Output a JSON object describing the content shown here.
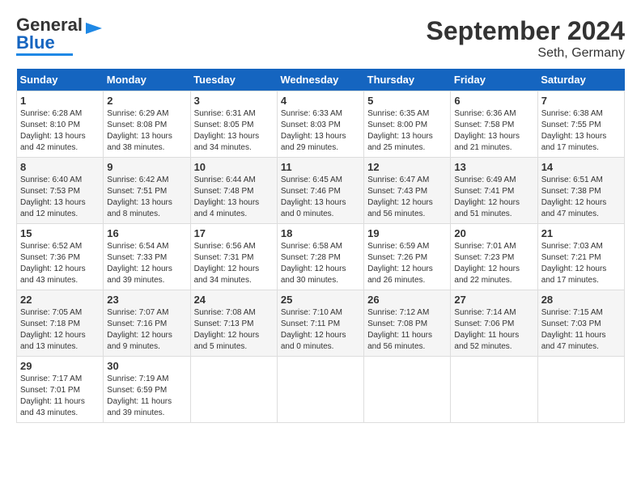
{
  "header": {
    "logo_general": "General",
    "logo_blue": "Blue",
    "title": "September 2024",
    "subtitle": "Seth, Germany"
  },
  "days_of_week": [
    "Sunday",
    "Monday",
    "Tuesday",
    "Wednesday",
    "Thursday",
    "Friday",
    "Saturday"
  ],
  "weeks": [
    [
      {
        "day": "1",
        "info": "Sunrise: 6:28 AM\nSunset: 8:10 PM\nDaylight: 13 hours\nand 42 minutes."
      },
      {
        "day": "2",
        "info": "Sunrise: 6:29 AM\nSunset: 8:08 PM\nDaylight: 13 hours\nand 38 minutes."
      },
      {
        "day": "3",
        "info": "Sunrise: 6:31 AM\nSunset: 8:05 PM\nDaylight: 13 hours\nand 34 minutes."
      },
      {
        "day": "4",
        "info": "Sunrise: 6:33 AM\nSunset: 8:03 PM\nDaylight: 13 hours\nand 29 minutes."
      },
      {
        "day": "5",
        "info": "Sunrise: 6:35 AM\nSunset: 8:00 PM\nDaylight: 13 hours\nand 25 minutes."
      },
      {
        "day": "6",
        "info": "Sunrise: 6:36 AM\nSunset: 7:58 PM\nDaylight: 13 hours\nand 21 minutes."
      },
      {
        "day": "7",
        "info": "Sunrise: 6:38 AM\nSunset: 7:55 PM\nDaylight: 13 hours\nand 17 minutes."
      }
    ],
    [
      {
        "day": "8",
        "info": "Sunrise: 6:40 AM\nSunset: 7:53 PM\nDaylight: 13 hours\nand 12 minutes."
      },
      {
        "day": "9",
        "info": "Sunrise: 6:42 AM\nSunset: 7:51 PM\nDaylight: 13 hours\nand 8 minutes."
      },
      {
        "day": "10",
        "info": "Sunrise: 6:44 AM\nSunset: 7:48 PM\nDaylight: 13 hours\nand 4 minutes."
      },
      {
        "day": "11",
        "info": "Sunrise: 6:45 AM\nSunset: 7:46 PM\nDaylight: 13 hours\nand 0 minutes."
      },
      {
        "day": "12",
        "info": "Sunrise: 6:47 AM\nSunset: 7:43 PM\nDaylight: 12 hours\nand 56 minutes."
      },
      {
        "day": "13",
        "info": "Sunrise: 6:49 AM\nSunset: 7:41 PM\nDaylight: 12 hours\nand 51 minutes."
      },
      {
        "day": "14",
        "info": "Sunrise: 6:51 AM\nSunset: 7:38 PM\nDaylight: 12 hours\nand 47 minutes."
      }
    ],
    [
      {
        "day": "15",
        "info": "Sunrise: 6:52 AM\nSunset: 7:36 PM\nDaylight: 12 hours\nand 43 minutes."
      },
      {
        "day": "16",
        "info": "Sunrise: 6:54 AM\nSunset: 7:33 PM\nDaylight: 12 hours\nand 39 minutes."
      },
      {
        "day": "17",
        "info": "Sunrise: 6:56 AM\nSunset: 7:31 PM\nDaylight: 12 hours\nand 34 minutes."
      },
      {
        "day": "18",
        "info": "Sunrise: 6:58 AM\nSunset: 7:28 PM\nDaylight: 12 hours\nand 30 minutes."
      },
      {
        "day": "19",
        "info": "Sunrise: 6:59 AM\nSunset: 7:26 PM\nDaylight: 12 hours\nand 26 minutes."
      },
      {
        "day": "20",
        "info": "Sunrise: 7:01 AM\nSunset: 7:23 PM\nDaylight: 12 hours\nand 22 minutes."
      },
      {
        "day": "21",
        "info": "Sunrise: 7:03 AM\nSunset: 7:21 PM\nDaylight: 12 hours\nand 17 minutes."
      }
    ],
    [
      {
        "day": "22",
        "info": "Sunrise: 7:05 AM\nSunset: 7:18 PM\nDaylight: 12 hours\nand 13 minutes."
      },
      {
        "day": "23",
        "info": "Sunrise: 7:07 AM\nSunset: 7:16 PM\nDaylight: 12 hours\nand 9 minutes."
      },
      {
        "day": "24",
        "info": "Sunrise: 7:08 AM\nSunset: 7:13 PM\nDaylight: 12 hours\nand 5 minutes."
      },
      {
        "day": "25",
        "info": "Sunrise: 7:10 AM\nSunset: 7:11 PM\nDaylight: 12 hours\nand 0 minutes."
      },
      {
        "day": "26",
        "info": "Sunrise: 7:12 AM\nSunset: 7:08 PM\nDaylight: 11 hours\nand 56 minutes."
      },
      {
        "day": "27",
        "info": "Sunrise: 7:14 AM\nSunset: 7:06 PM\nDaylight: 11 hours\nand 52 minutes."
      },
      {
        "day": "28",
        "info": "Sunrise: 7:15 AM\nSunset: 7:03 PM\nDaylight: 11 hours\nand 47 minutes."
      }
    ],
    [
      {
        "day": "29",
        "info": "Sunrise: 7:17 AM\nSunset: 7:01 PM\nDaylight: 11 hours\nand 43 minutes."
      },
      {
        "day": "30",
        "info": "Sunrise: 7:19 AM\nSunset: 6:59 PM\nDaylight: 11 hours\nand 39 minutes."
      },
      {
        "day": "",
        "info": ""
      },
      {
        "day": "",
        "info": ""
      },
      {
        "day": "",
        "info": ""
      },
      {
        "day": "",
        "info": ""
      },
      {
        "day": "",
        "info": ""
      }
    ]
  ]
}
